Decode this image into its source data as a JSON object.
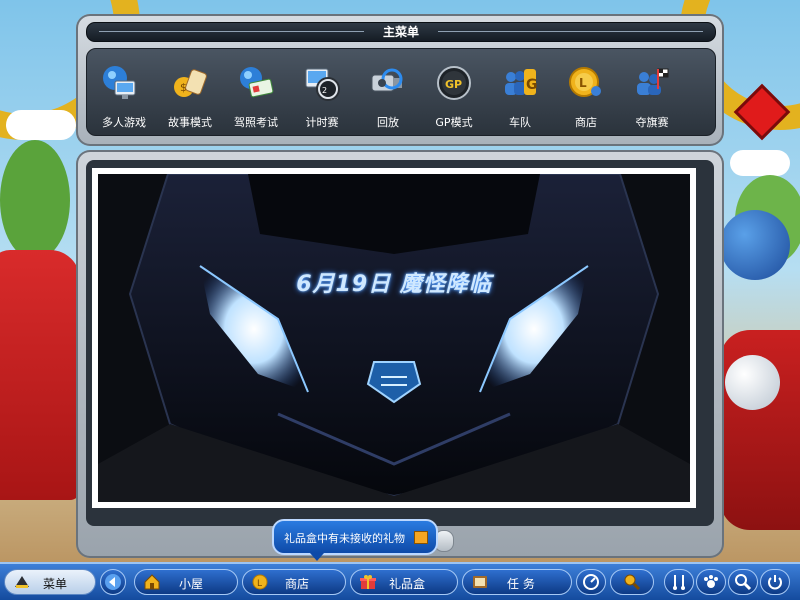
{
  "menu": {
    "title": "主菜单",
    "items": [
      {
        "label": "多人游戏",
        "icon": "globe-monitor-icon"
      },
      {
        "label": "故事模式",
        "icon": "scroll-icon"
      },
      {
        "label": "驾照考试",
        "icon": "license-icon"
      },
      {
        "label": "计时赛",
        "icon": "stopwatch-icon"
      },
      {
        "label": "回放",
        "icon": "video-camera-icon"
      },
      {
        "label": "GP模式",
        "icon": "gp-badge-icon"
      },
      {
        "label": "车队",
        "icon": "team-icon"
      },
      {
        "label": "商店",
        "icon": "coin-icon"
      },
      {
        "label": "夺旗赛",
        "icon": "flag-race-icon"
      }
    ]
  },
  "banner": {
    "headline": "6月19日  魔怪降临"
  },
  "tooltip": {
    "text": "礼品盒中有未接收的礼物"
  },
  "taskbar": {
    "start_label": "菜单",
    "house_label": "小屋",
    "shop_label": "商店",
    "gift_label": "礼品盒",
    "task_label": "任  务"
  },
  "colors": {
    "accent_blue": "#144b9e",
    "panel_gray": "#a8b1ba",
    "banner_glow": "#3d8cff"
  }
}
